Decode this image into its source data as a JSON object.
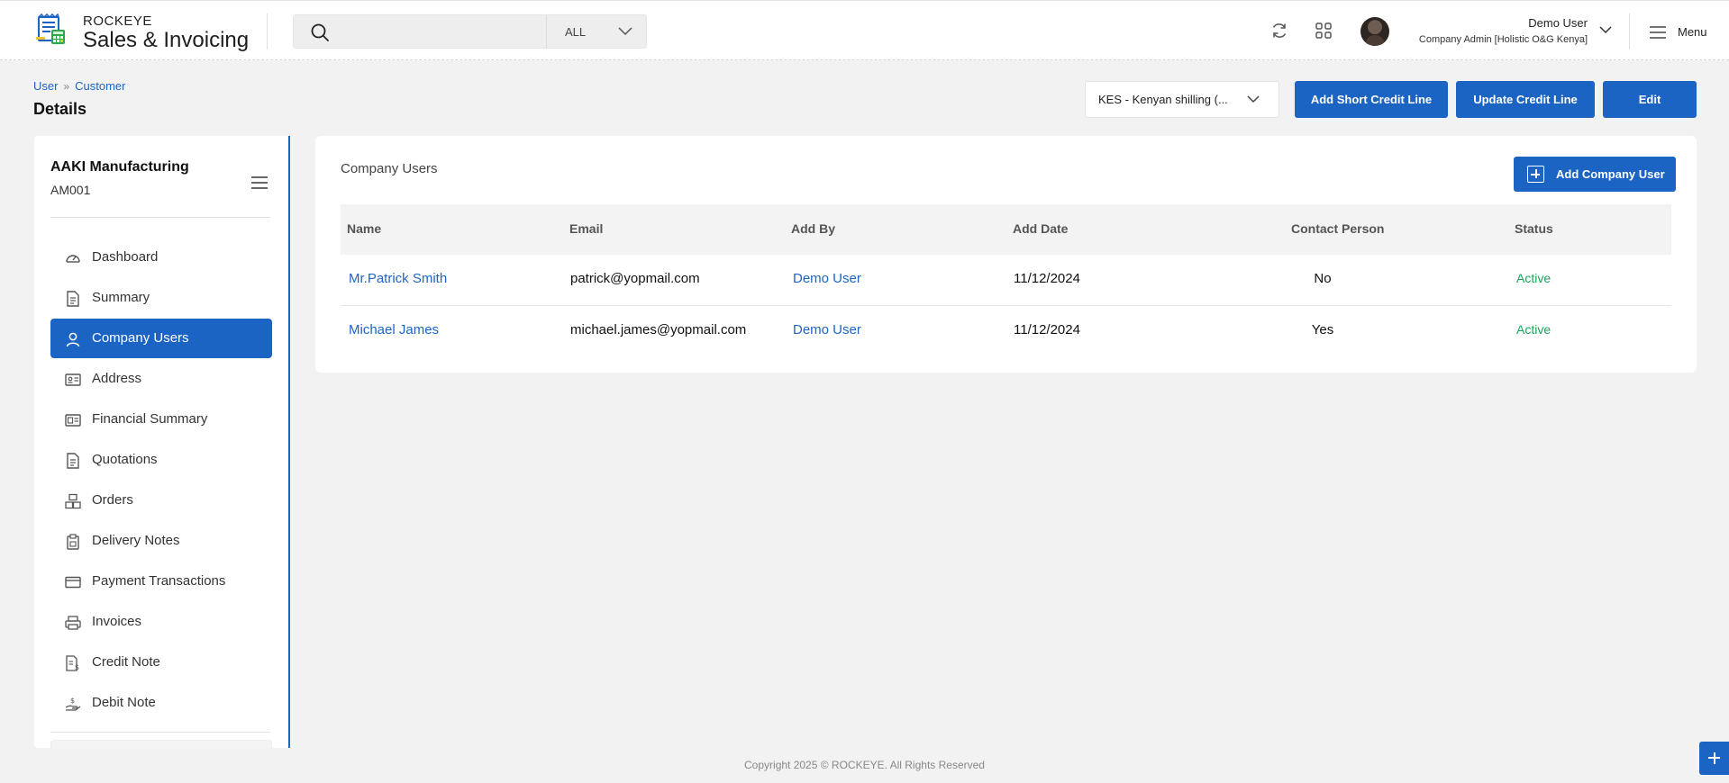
{
  "header": {
    "brand_top": "ROCKEYE",
    "brand_bottom": "Sales & Invoicing",
    "search_placeholder": "",
    "search_filter": "ALL",
    "user_name": "Demo User",
    "user_role": "Company Admin [Holistic O&G Kenya]",
    "menu_label": "Menu"
  },
  "breadcrumb": {
    "items": [
      "User",
      "Customer"
    ]
  },
  "page_title": "Details",
  "toolbar": {
    "currency": "KES - Kenyan shilling (...",
    "add_short_credit_line": "Add Short Credit Line",
    "update_credit_line": "Update Credit Line",
    "edit": "Edit"
  },
  "sidebar": {
    "company_name": "AAKI Manufacturing",
    "company_code": "AM001",
    "items": [
      {
        "label": "Dashboard",
        "icon": "dashboard-icon"
      },
      {
        "label": "Summary",
        "icon": "document-icon"
      },
      {
        "label": "Company Users",
        "icon": "user-icon",
        "active": true
      },
      {
        "label": "Address",
        "icon": "address-card-icon"
      },
      {
        "label": "Financial Summary",
        "icon": "money-card-icon"
      },
      {
        "label": "Quotations",
        "icon": "document-icon"
      },
      {
        "label": "Orders",
        "icon": "boxes-icon"
      },
      {
        "label": "Delivery Notes",
        "icon": "clipboard-icon"
      },
      {
        "label": "Payment Transactions",
        "icon": "card-icon"
      },
      {
        "label": "Invoices",
        "icon": "printer-icon"
      },
      {
        "label": "Credit Note",
        "icon": "credit-note-icon"
      },
      {
        "label": "Debit Note",
        "icon": "hand-money-icon"
      }
    ]
  },
  "main": {
    "section_title": "Company Users",
    "add_button": "Add Company User",
    "columns": [
      "Name",
      "Email",
      "Add By",
      "Add Date",
      "Contact Person",
      "Status"
    ],
    "rows": [
      {
        "name": "Mr.Patrick Smith",
        "email": "patrick@yopmail.com",
        "added_by": "Demo User",
        "date": "11/12/2024",
        "contact": "No",
        "status": "Active"
      },
      {
        "name": "Michael James",
        "email": "michael.james@yopmail.com",
        "added_by": "Demo User",
        "date": "11/12/2024",
        "contact": "Yes",
        "status": "Active"
      }
    ]
  },
  "footer": "Copyright 2025 © ROCKEYE. All Rights Reserved",
  "colors": {
    "primary": "#1b64c4",
    "status_active": "#1aa55a",
    "link": "#1f64c3"
  }
}
